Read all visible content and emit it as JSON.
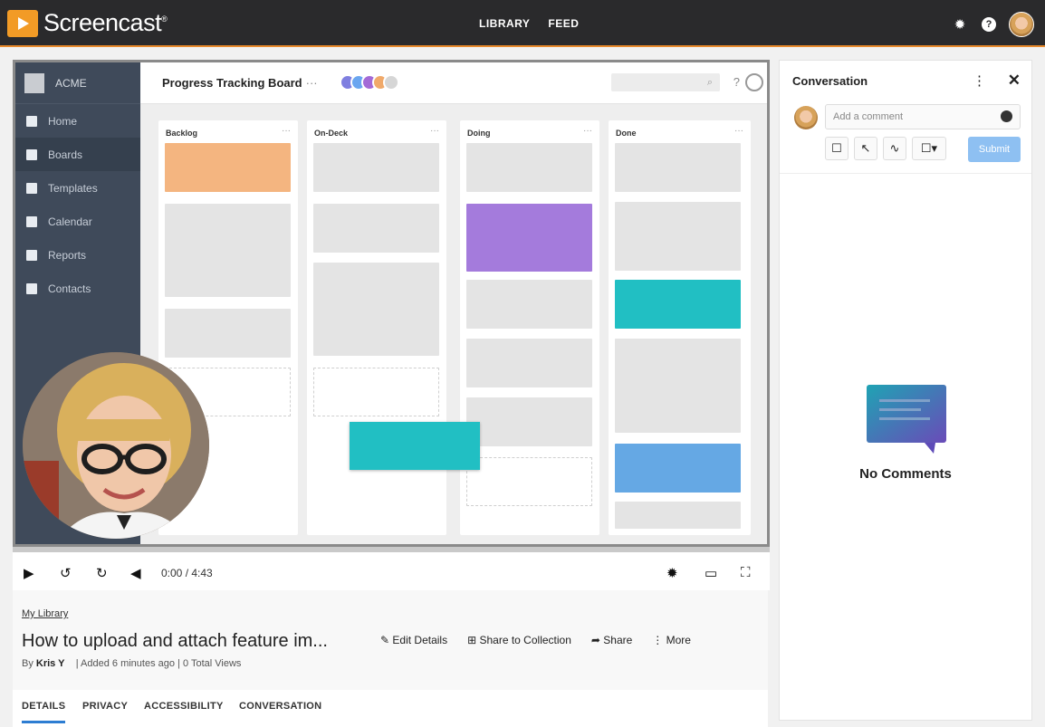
{
  "app": {
    "logo_text": "Screencast",
    "logo_mark": "®",
    "nav": [
      "LIBRARY",
      "FEED"
    ],
    "icons": [
      "gear-icon",
      "help-icon",
      "user-avatar"
    ]
  },
  "board": {
    "org": "ACME",
    "title": "Progress Tracking Board",
    "title_more": "···",
    "search_icon": "⌕",
    "help": "?",
    "sidebar": [
      {
        "label": "Home",
        "icon": "home-icon"
      },
      {
        "label": "Boards",
        "icon": "boards-icon"
      },
      {
        "label": "Templates",
        "icon": "templates-icon"
      },
      {
        "label": "Calendar",
        "icon": "calendar-icon"
      },
      {
        "label": "Reports",
        "icon": "reports-icon"
      },
      {
        "label": "Contacts",
        "icon": "contacts-icon"
      }
    ],
    "columns": [
      {
        "title": "Backlog",
        "more": "···"
      },
      {
        "title": "On-Deck",
        "more": "···"
      },
      {
        "title": "Doing",
        "more": "···"
      },
      {
        "title": "Done",
        "more": "···"
      }
    ],
    "colors": {
      "orange": "#f4b580",
      "purple": "#a47bdc",
      "teal": "#21bfc3",
      "blue": "#65a8e4"
    }
  },
  "player": {
    "time": "0:00 / 4:43"
  },
  "video": {
    "breadcrumb": "My Library",
    "title": "How to upload and attach feature im...",
    "actions": {
      "edit": "Edit Details",
      "collection": "Share to Collection",
      "share": "Share",
      "more": "More"
    },
    "author_prefix": "By",
    "author": "Kris Y",
    "meta": "| Added 6 minutes ago | 0 Total Views",
    "tabs": [
      "DETAILS",
      "PRIVACY",
      "ACCESSIBILITY",
      "CONVERSATION"
    ]
  },
  "conversation": {
    "title": "Conversation",
    "placeholder": "Add a comment",
    "submit": "Submit",
    "empty": "No Comments"
  }
}
